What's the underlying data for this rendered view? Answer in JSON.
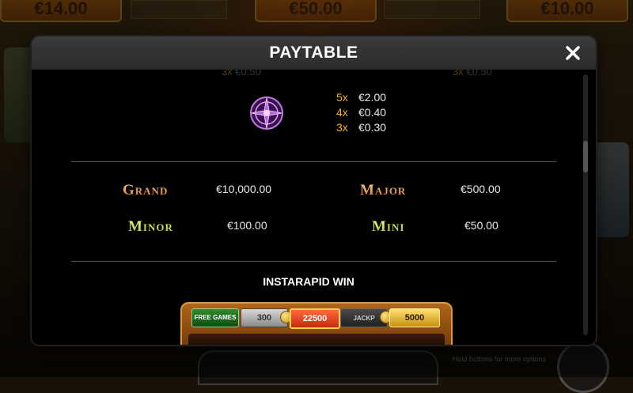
{
  "background": {
    "top_values": [
      "€14.00",
      "€50.00",
      "€10.00"
    ],
    "info_text": "Hold buttons for more options"
  },
  "modal": {
    "title": "PAYTABLE",
    "close_icon": "close-icon"
  },
  "faded_row": {
    "left": {
      "mult": "3x",
      "amt": "€0.50"
    },
    "right": {
      "mult": "3x",
      "amt": "€0.50"
    }
  },
  "symbol_payouts": {
    "icon": "compass-emblem-icon",
    "rows": [
      {
        "mult": "5x",
        "amt": "€2.00"
      },
      {
        "mult": "4x",
        "amt": "€0.40"
      },
      {
        "mult": "3x",
        "amt": "€0.30"
      }
    ]
  },
  "jackpots": {
    "grand": {
      "label": "Grand",
      "value": "€10,000.00"
    },
    "major": {
      "label": "Major",
      "value": "€500.00"
    },
    "minor": {
      "label": "Minor",
      "value": "€100.00"
    },
    "mini": {
      "label": "Mini",
      "value": "€50.00"
    }
  },
  "instarapid": {
    "title": "INSTARAPID WIN",
    "cells": {
      "free": "FREE GAMES",
      "c300": "300",
      "c22500": "22500",
      "jack": "JACKP",
      "c5000": "5000"
    }
  },
  "colors": {
    "multiplier": "#f0b020",
    "grand_major": "#f0a040",
    "minor_mini": "#d8e040",
    "header": "#2f2f2f"
  }
}
